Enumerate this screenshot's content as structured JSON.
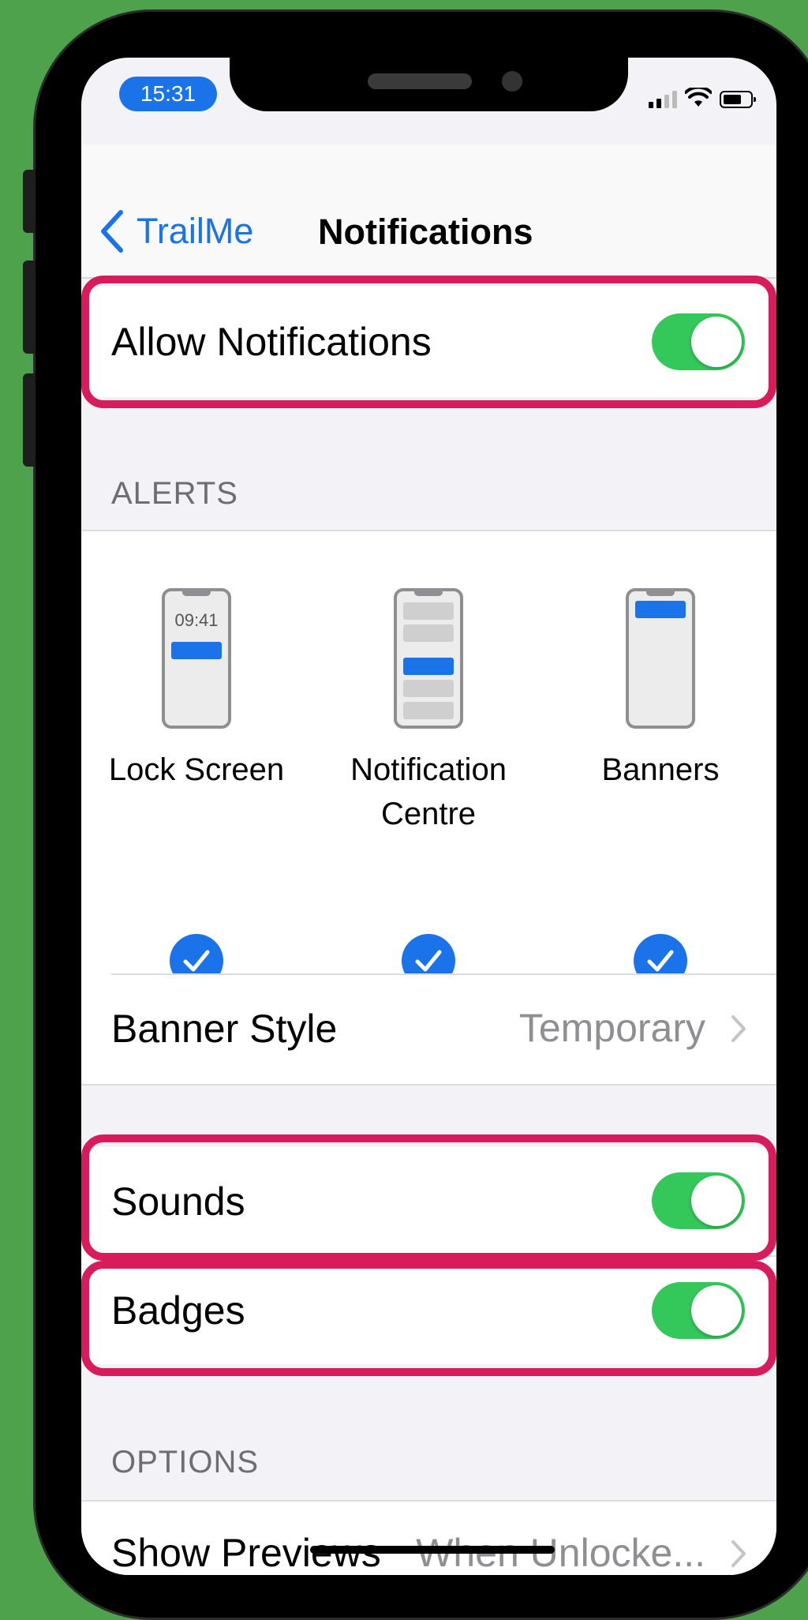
{
  "status": {
    "time": "15:31"
  },
  "nav": {
    "back_label": "TrailMe",
    "title": "Notifications"
  },
  "allow_notifications": {
    "label": "Allow Notifications",
    "on": true
  },
  "alerts": {
    "header": "ALERTS",
    "items": [
      {
        "label_line1": "Lock Screen",
        "label_line2": "",
        "mini_time": "09:41",
        "checked": true
      },
      {
        "label_line1": "Notification",
        "label_line2": "Centre",
        "checked": true
      },
      {
        "label_line1": "Banners",
        "label_line2": "",
        "checked": true
      }
    ],
    "banner_style": {
      "label": "Banner Style",
      "value": "Temporary"
    }
  },
  "sounds": {
    "label": "Sounds",
    "on": true
  },
  "badges": {
    "label": "Badges",
    "on": true
  },
  "options": {
    "header": "OPTIONS",
    "show_previews": {
      "label": "Show Previews",
      "value": "When Unlocke..."
    }
  },
  "colors": {
    "accent": "#1a73e8",
    "toggle_on": "#34c759",
    "highlight": "#d81b5a",
    "background": "#4ea24c"
  },
  "icons": {
    "back": "chevron-left-icon",
    "check": "checkmark-icon",
    "disclosure": "chevron-right-icon"
  }
}
